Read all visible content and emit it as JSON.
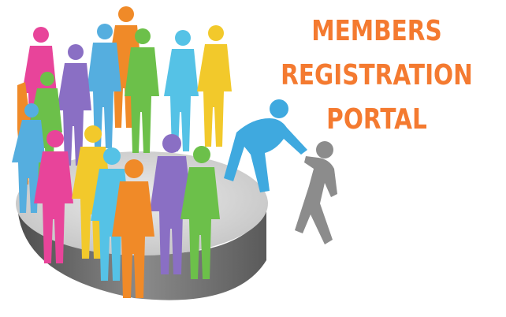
{
  "title": {
    "line1": "MEMBERS",
    "line2": "REGISTRATION",
    "line3": "PORTAL"
  },
  "colors": {
    "title": "#f47a30",
    "platform_top": "#d5d5d5",
    "platform_side": "#6f6f6f",
    "helper": "#3fa9df",
    "newcomer": "#8c8c8c",
    "person_orange": "#f08a28",
    "person_green": "#6cc04a",
    "person_purple": "#8a6fc4",
    "person_pink": "#e8449a",
    "person_blue": "#55aedf",
    "person_yellow": "#f2c92b"
  },
  "icons": {
    "crowd": "people-crowd-icon",
    "platform": "platform-disc-icon",
    "helper": "helping-person-icon",
    "newcomer": "new-member-icon"
  }
}
